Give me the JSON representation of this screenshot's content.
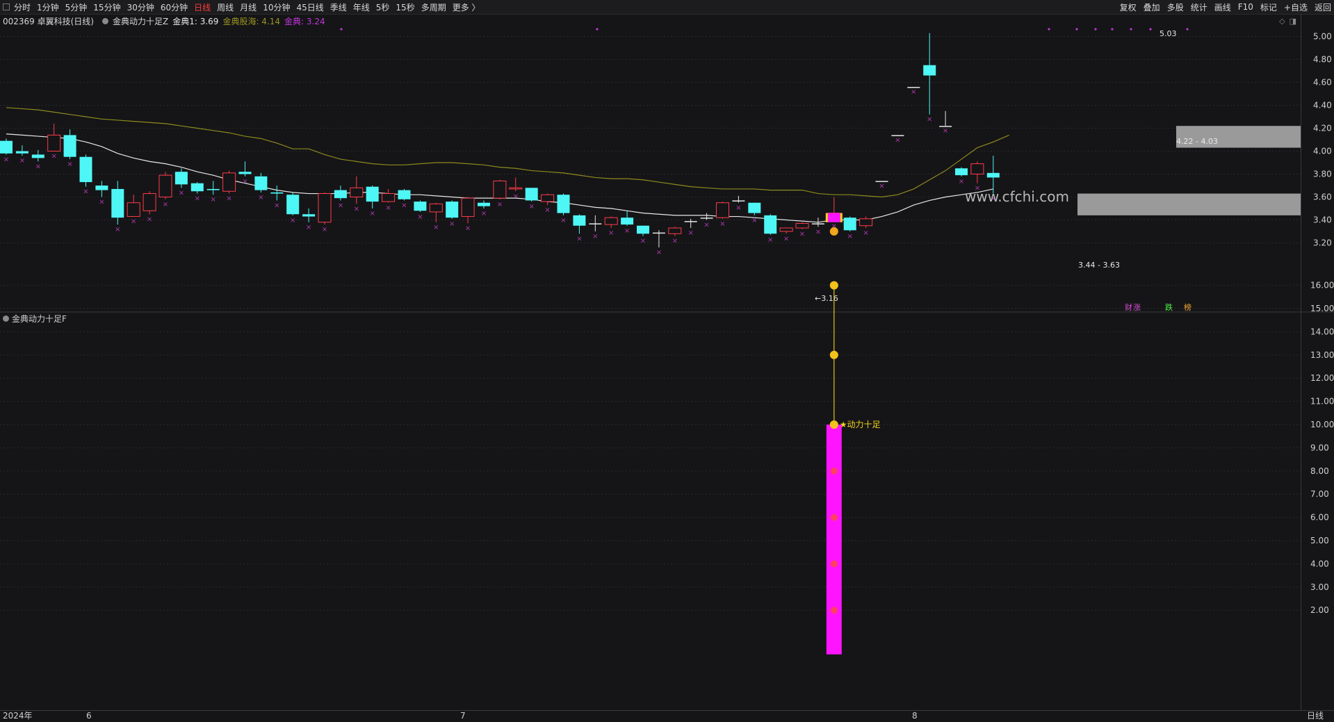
{
  "toolbar": {
    "periods": [
      "分时",
      "1分钟",
      "5分钟",
      "15分钟",
      "30分钟",
      "60分钟",
      "日线",
      "周线",
      "月线",
      "10分钟",
      "45日线",
      "季线",
      "年线",
      "5秒",
      "15秒",
      "多周期",
      "更多 〉"
    ],
    "active_period": "日线",
    "right_tools": [
      "复权",
      "叠加",
      "多股",
      "统计",
      "画线",
      "F10",
      "标记",
      "+自选",
      "返回"
    ]
  },
  "main": {
    "stock": "002369 卓翼科技(日线)",
    "indicator_name": "金典动力十足Z",
    "jd1": "金典1: 3.69",
    "gh": "金典股海: 4.14",
    "jd": "金典: 3.24",
    "watermark": "www.cfchi.com",
    "annotations": {
      "high": "5.03",
      "low": "3.16",
      "zone_upper": "4.22 - 4.03",
      "zone_lower": "3.44 - 3.63"
    },
    "badges": [
      "财",
      "涨",
      "跌",
      "榜"
    ],
    "colors": {
      "up": "#ff3b4b",
      "down": "#4ef6f6",
      "ma1": "#e8e8e8",
      "ma2": "#8e8a1e",
      "cross": "#b03ab0",
      "zone": "#9a9a9a"
    }
  },
  "sub": {
    "indicator_name": "金典动力十足F",
    "signal_label": "★动力十足",
    "colors": {
      "bar": "#ff14ff",
      "line": "#e6c21a"
    }
  },
  "axes": {
    "main_ticks": [
      "5.00",
      "4.80",
      "4.60",
      "4.40",
      "4.20",
      "4.00",
      "3.80",
      "3.60",
      "3.40",
      "3.20"
    ],
    "sub_ticks": [
      "16.00",
      "15.00",
      "14.00",
      "13.00",
      "12.00",
      "11.00",
      "10.00",
      "9.00",
      "8.00",
      "7.00",
      "6.00",
      "5.00",
      "4.00",
      "3.00",
      "2.00"
    ],
    "x_labels": [
      "2024年",
      "6",
      "7",
      "8"
    ],
    "x_unit": "日线"
  },
  "chart_data": {
    "type": "candlestick",
    "ylim": [
      3.1,
      5.1
    ],
    "candles": [
      {
        "o": 4.09,
        "c": 3.98,
        "h": 4.11,
        "l": 3.97
      },
      {
        "o": 4.0,
        "c": 3.98,
        "h": 4.05,
        "l": 3.96
      },
      {
        "o": 3.97,
        "c": 3.94,
        "h": 4.01,
        "l": 3.91
      },
      {
        "o": 4.0,
        "c": 4.14,
        "h": 4.24,
        "l": 4.0
      },
      {
        "o": 4.14,
        "c": 3.95,
        "h": 4.19,
        "l": 3.93
      },
      {
        "o": 3.95,
        "c": 3.73,
        "h": 3.97,
        "l": 3.69
      },
      {
        "o": 3.7,
        "c": 3.66,
        "h": 3.74,
        "l": 3.6
      },
      {
        "o": 3.67,
        "c": 3.42,
        "h": 3.74,
        "l": 3.36
      },
      {
        "o": 3.43,
        "c": 3.55,
        "h": 3.62,
        "l": 3.43
      },
      {
        "o": 3.48,
        "c": 3.63,
        "h": 3.65,
        "l": 3.45
      },
      {
        "o": 3.6,
        "c": 3.79,
        "h": 3.82,
        "l": 3.58
      },
      {
        "o": 3.82,
        "c": 3.71,
        "h": 3.85,
        "l": 3.68
      },
      {
        "o": 3.72,
        "c": 3.65,
        "h": 3.73,
        "l": 3.63
      },
      {
        "o": 3.67,
        "c": 3.66,
        "h": 3.74,
        "l": 3.62
      },
      {
        "o": 3.65,
        "c": 3.81,
        "h": 3.83,
        "l": 3.63
      },
      {
        "o": 3.82,
        "c": 3.8,
        "h": 3.91,
        "l": 3.78
      },
      {
        "o": 3.78,
        "c": 3.66,
        "h": 3.81,
        "l": 3.64
      },
      {
        "o": 3.64,
        "c": 3.63,
        "h": 3.7,
        "l": 3.57
      },
      {
        "o": 3.62,
        "c": 3.45,
        "h": 3.64,
        "l": 3.44
      },
      {
        "o": 3.45,
        "c": 3.43,
        "h": 3.5,
        "l": 3.38
      },
      {
        "o": 3.38,
        "c": 3.63,
        "h": 3.64,
        "l": 3.36
      },
      {
        "o": 3.66,
        "c": 3.59,
        "h": 3.7,
        "l": 3.57
      },
      {
        "o": 3.6,
        "c": 3.68,
        "h": 3.78,
        "l": 3.54
      },
      {
        "o": 3.69,
        "c": 3.56,
        "h": 3.7,
        "l": 3.5
      },
      {
        "o": 3.56,
        "c": 3.63,
        "h": 3.67,
        "l": 3.55
      },
      {
        "o": 3.66,
        "c": 3.58,
        "h": 3.67,
        "l": 3.57
      },
      {
        "o": 3.56,
        "c": 3.48,
        "h": 3.57,
        "l": 3.47
      },
      {
        "o": 3.47,
        "c": 3.54,
        "h": 3.55,
        "l": 3.38
      },
      {
        "o": 3.56,
        "c": 3.42,
        "h": 3.57,
        "l": 3.41
      },
      {
        "o": 3.43,
        "c": 3.59,
        "h": 3.6,
        "l": 3.37
      },
      {
        "o": 3.55,
        "c": 3.52,
        "h": 3.57,
        "l": 3.5
      },
      {
        "o": 3.59,
        "c": 3.74,
        "h": 3.75,
        "l": 3.58
      },
      {
        "o": 3.67,
        "c": 3.68,
        "h": 3.77,
        "l": 3.65
      },
      {
        "o": 3.68,
        "c": 3.57,
        "h": 3.68,
        "l": 3.56
      },
      {
        "o": 3.56,
        "c": 3.62,
        "h": 3.63,
        "l": 3.53
      },
      {
        "o": 3.62,
        "c": 3.46,
        "h": 3.63,
        "l": 3.44
      },
      {
        "o": 3.44,
        "c": 3.35,
        "h": 3.45,
        "l": 3.28
      },
      {
        "o": 3.37,
        "c": 3.37,
        "h": 3.44,
        "l": 3.3
      },
      {
        "o": 3.36,
        "c": 3.42,
        "h": 3.43,
        "l": 3.33
      },
      {
        "o": 3.42,
        "c": 3.36,
        "h": 3.48,
        "l": 3.35
      },
      {
        "o": 3.35,
        "c": 3.28,
        "h": 3.35,
        "l": 3.26
      },
      {
        "o": 3.29,
        "c": 3.29,
        "h": 3.31,
        "l": 3.16
      },
      {
        "o": 3.28,
        "c": 3.33,
        "h": 3.34,
        "l": 3.26
      },
      {
        "o": 3.39,
        "c": 3.39,
        "h": 3.41,
        "l": 3.33
      },
      {
        "o": 3.42,
        "c": 3.42,
        "h": 3.46,
        "l": 3.4
      },
      {
        "o": 3.42,
        "c": 3.55,
        "h": 3.56,
        "l": 3.41
      },
      {
        "o": 3.57,
        "c": 3.57,
        "h": 3.61,
        "l": 3.55
      },
      {
        "o": 3.55,
        "c": 3.46,
        "h": 3.55,
        "l": 3.44
      },
      {
        "o": 3.44,
        "c": 3.28,
        "h": 3.45,
        "l": 3.27
      },
      {
        "o": 3.3,
        "c": 3.33,
        "h": 3.33,
        "l": 3.28
      },
      {
        "o": 3.33,
        "c": 3.37,
        "h": 3.38,
        "l": 3.32
      },
      {
        "o": 3.37,
        "c": 3.37,
        "h": 3.42,
        "l": 3.34
      },
      {
        "o": 3.4,
        "c": 3.46,
        "h": 3.6,
        "l": 3.39
      },
      {
        "o": 3.42,
        "c": 3.31,
        "h": 3.43,
        "l": 3.3
      },
      {
        "o": 3.35,
        "c": 3.41,
        "h": 3.43,
        "l": 3.33
      },
      {
        "o": 3.74,
        "c": 3.74,
        "h": 3.74,
        "l": 3.74
      },
      {
        "o": 4.14,
        "c": 4.14,
        "h": 4.14,
        "l": 4.14
      },
      {
        "o": 4.56,
        "c": 4.56,
        "h": 4.56,
        "l": 4.56
      },
      {
        "o": 4.75,
        "c": 4.66,
        "h": 5.03,
        "l": 4.32
      },
      {
        "o": 4.22,
        "c": 4.22,
        "h": 4.35,
        "l": 4.22
      },
      {
        "o": 3.85,
        "c": 3.79,
        "h": 3.86,
        "l": 3.78
      },
      {
        "o": 3.8,
        "c": 3.89,
        "h": 3.91,
        "l": 3.72
      },
      {
        "o": 3.81,
        "c": 3.77,
        "h": 3.96,
        "l": 3.63
      }
    ],
    "ma1": [
      4.15,
      4.14,
      4.13,
      4.12,
      4.11,
      4.08,
      4.04,
      3.98,
      3.94,
      3.91,
      3.89,
      3.86,
      3.82,
      3.79,
      3.75,
      3.72,
      3.69,
      3.66,
      3.64,
      3.63,
      3.63,
      3.63,
      3.64,
      3.64,
      3.63,
      3.62,
      3.62,
      3.61,
      3.6,
      3.59,
      3.59,
      3.59,
      3.59,
      3.58,
      3.56,
      3.55,
      3.53,
      3.51,
      3.5,
      3.48,
      3.46,
      3.45,
      3.44,
      3.44,
      3.44,
      3.43,
      3.43,
      3.42,
      3.41,
      3.4,
      3.39,
      3.38,
      3.4,
      3.4,
      3.4,
      3.43,
      3.47,
      3.53,
      3.57,
      3.6,
      3.62,
      3.64,
      3.67
    ],
    "ma2": [
      4.38,
      4.37,
      4.36,
      4.34,
      4.32,
      4.3,
      4.28,
      4.27,
      4.26,
      4.25,
      4.24,
      4.22,
      4.2,
      4.18,
      4.16,
      4.13,
      4.11,
      4.07,
      4.02,
      4.02,
      3.97,
      3.93,
      3.91,
      3.89,
      3.88,
      3.88,
      3.89,
      3.9,
      3.9,
      3.89,
      3.88,
      3.86,
      3.85,
      3.83,
      3.82,
      3.81,
      3.79,
      3.77,
      3.76,
      3.76,
      3.75,
      3.73,
      3.71,
      3.69,
      3.68,
      3.67,
      3.67,
      3.67,
      3.66,
      3.66,
      3.66,
      3.63,
      3.62,
      3.62,
      3.61,
      3.6,
      3.62,
      3.67,
      3.75,
      3.83,
      3.93,
      4.03,
      4.08,
      4.14
    ],
    "sub_signal": {
      "bar_top": 10.0,
      "bar_bottom": 0.1,
      "line_top": 16.0,
      "markers": [
        16.0,
        13.0,
        10.0,
        8.0,
        6.0,
        4.0,
        2.0
      ]
    }
  }
}
